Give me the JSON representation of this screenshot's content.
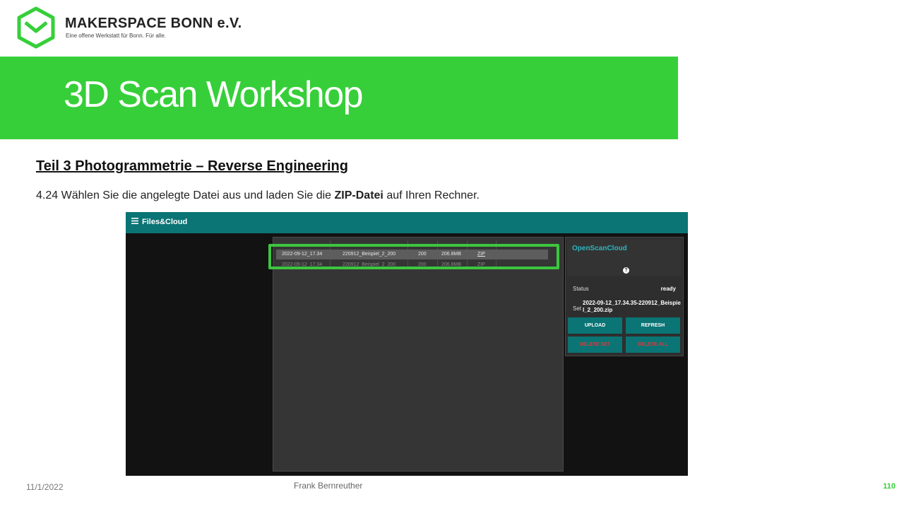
{
  "brand": {
    "name": "MAKERSPACE BONN e.V.",
    "tagline": "Eine offene Werkstatt für Bonn. Für alle.",
    "logo_icon": "hexagon-m-logo-icon",
    "accent_color": "#36cf39"
  },
  "banner": {
    "title": "3D Scan Workshop"
  },
  "content": {
    "heading": "Teil 3  Photogrammetrie  – Reverse Engineering",
    "instruction_prefix": "4.24 Wählen Sie die angelegte Datei aus und laden Sie die ",
    "instruction_bold": "ZIP-Datei",
    "instruction_suffix": " auf Ihren Rechner."
  },
  "app": {
    "menu_icon": "hamburger-menu-icon",
    "title": "Files&Cloud",
    "files": [
      {
        "date": "2022-09-12_17.34",
        "name": "220912_Beispiel_2_200",
        "count": "200",
        "size": "206.8MB",
        "action": "ZIP"
      },
      {
        "date": "2022-09-12_17.34",
        "name": "220912_Beispiel_2_200",
        "count": "200",
        "size": "206.8MB",
        "action": "ZIP"
      }
    ],
    "cloud": {
      "title": "OpenScanCloud",
      "help_icon": "help-icon",
      "status_label": "Status",
      "status_value": "ready",
      "set_label": "Set",
      "set_value": "2022-09-12_17.34.35-220912_Beispiel_2_200.zip",
      "buttons": {
        "upload": "UPLOAD",
        "refresh": "REFRESH",
        "delete_set": "DELETE SET",
        "delete_all": "DELETE ALL"
      }
    }
  },
  "footer": {
    "date": "11/1/2022",
    "author": "Frank Bernreuther",
    "page": "110"
  }
}
